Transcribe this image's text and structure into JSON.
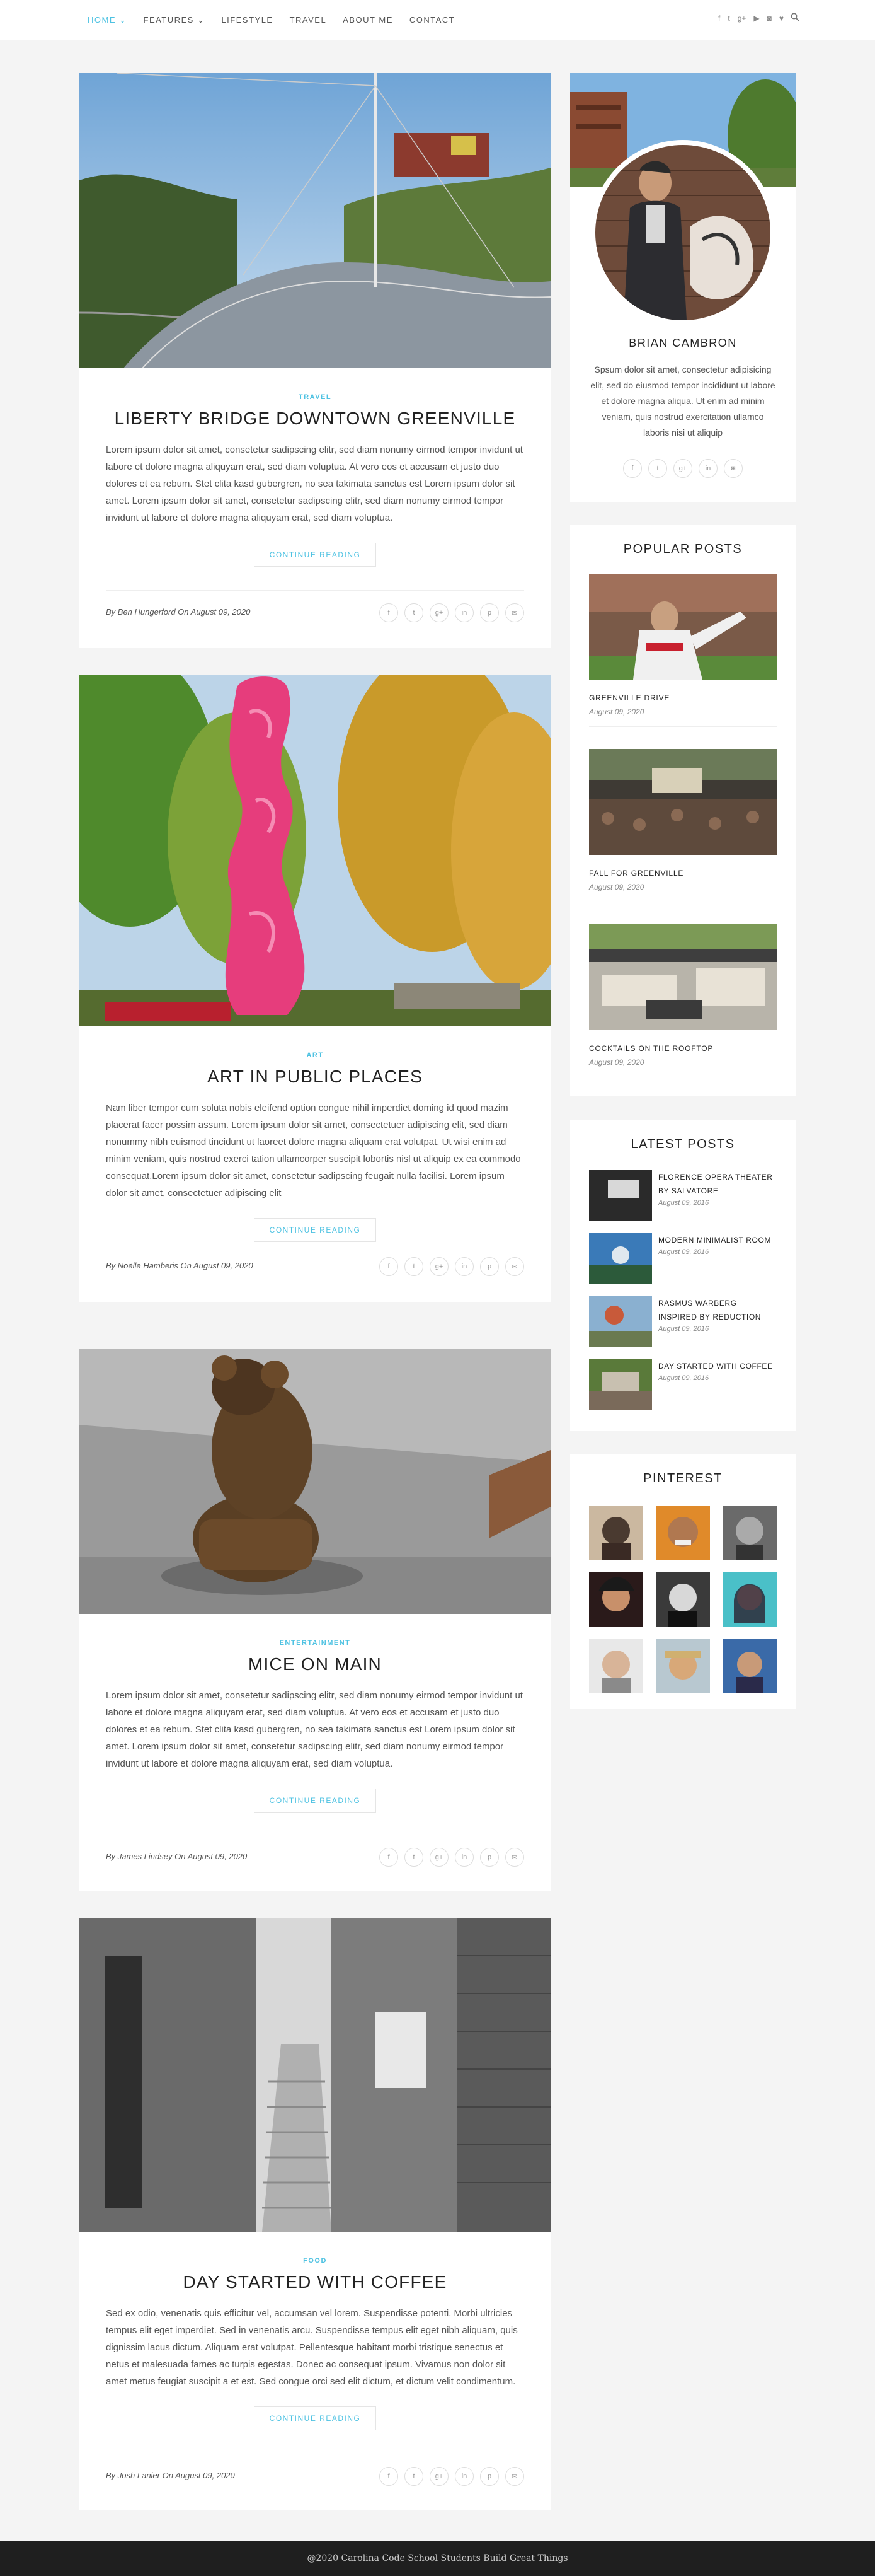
{
  "nav": {
    "items": [
      "HOME",
      "FEATURES",
      "LIFESTYLE",
      "TRAVEL",
      "ABOUT ME",
      "CONTACT"
    ],
    "dropdown_markers": [
      "⌄",
      "⌄"
    ],
    "social": [
      "f",
      "t",
      "g+",
      "▶",
      "◙",
      "♥"
    ],
    "accent": "#4ec2e2"
  },
  "posts": [
    {
      "category": "TRAVEL",
      "title": "LIBERTY BRIDGE DOWNTOWN GREENVILLE",
      "excerpt": "Lorem ipsum dolor sit amet, consetetur sadipscing elitr, sed diam nonumy eirmod tempor invidunt ut labore et dolore magna aliquyam erat, sed diam voluptua. At vero eos et accusam et justo duo dolores et ea rebum. Stet clita kasd gubergren, no sea takimata sanctus est Lorem ipsum dolor sit amet. Lorem ipsum dolor sit amet, consetetur sadipscing elitr, sed diam nonumy eirmod tempor invidunt ut labore et dolore magna aliquyam erat, sed diam voluptua.",
      "read_more": "CONTINUE READING",
      "author_line": "By Ben Hungerford On August 09, 2020"
    },
    {
      "category": "ART",
      "title": "ART IN PUBLIC PLACES",
      "excerpt": "Nam liber tempor cum soluta nobis eleifend option congue nihil imperdiet doming id quod mazim placerat facer possim assum. Lorem ipsum dolor sit amet, consectetuer adipiscing elit, sed diam nonummy nibh euismod tincidunt ut laoreet dolore magna aliquam erat volutpat. Ut wisi enim ad minim veniam, quis nostrud exerci tation ullamcorper suscipit lobortis nisl ut aliquip ex ea commodo consequat.Lorem ipsum dolor sit amet, consetetur sadipscing  feugait nulla facilisi. Lorem ipsum dolor sit amet, consectetuer adipiscing elit",
      "read_more": "CONTINUE READING",
      "author_line": "By Noëlle Hamberis On August 09, 2020"
    },
    {
      "category": "ENTERTAINMENT",
      "title": "MICE ON MAIN",
      "excerpt": "Lorem ipsum dolor sit amet, consetetur sadipscing elitr, sed diam nonumy eirmod tempor invidunt ut labore et dolore magna aliquyam erat, sed diam voluptua. At vero eos et accusam et justo duo dolores et ea rebum. Stet clita kasd gubergren, no sea takimata sanctus est Lorem ipsum dolor sit amet. Lorem ipsum dolor sit amet, consetetur sadipscing elitr, sed diam nonumy eirmod tempor invidunt ut labore et dolore magna aliquyam erat, sed diam voluptua.",
      "read_more": "CONTINUE READING",
      "author_line": "By James Lindsey On August 09, 2020"
    },
    {
      "category": "FOOD",
      "title": "DAY STARTED WITH COFFEE",
      "excerpt": "Sed ex odio, venenatis quis efficitur vel, accumsan vel lorem. Suspendisse potenti. Morbi ultricies tempus elit eget imperdiet. Sed in venenatis arcu. Suspendisse tempus elit eget nibh aliquam, quis dignissim lacus dictum. Aliquam erat volutpat. Pellentesque habitant morbi tristique senectus et netus et malesuada fames ac turpis egestas. Donec ac consequat ipsum. Vivamus non dolor sit amet metus feugiat suscipit a et est. Sed congue orci sed elit dictum, et dictum velit condimentum.",
      "read_more": "CONTINUE READING",
      "author_line": "By Josh Lanier On August 09, 2020"
    }
  ],
  "share_icons": [
    "f",
    "t",
    "g+",
    "in",
    "p",
    "✉"
  ],
  "about": {
    "name": "BRIAN CAMBRON",
    "text": "Spsum dolor sit amet, consectetur adipisicing elit, sed do eiusmod tempor incididunt ut labore et dolore magna aliqua. Ut enim ad minim veniam, quis nostrud exercitation ullamco laboris nisi ut aliquip",
    "social": [
      "f",
      "t",
      "g+",
      "in",
      "◙"
    ]
  },
  "popular": {
    "title": "POPULAR POSTS",
    "items": [
      {
        "name": "GREENVILLE DRIVE",
        "date": "August 09, 2020"
      },
      {
        "name": "FALL FOR GREENVILLE",
        "date": "August 09, 2020"
      },
      {
        "name": "COCKTAILS ON THE ROOFTOP",
        "date": "August 09, 2020"
      }
    ]
  },
  "latest": {
    "title": "LATEST POSTS",
    "items": [
      {
        "name": "FLORENCE OPERA THEATER BY SALVATORE",
        "date": "August 09, 2016"
      },
      {
        "name": "MODERN MINIMALIST ROOM",
        "date": "August 09, 2016"
      },
      {
        "name": "RASMUS WARBERG INSPIRED BY REDUCTION",
        "date": "August 09, 2016"
      },
      {
        "name": "DAY STARTED WITH COFFEE",
        "date": "August 09, 2016"
      }
    ]
  },
  "pinterest": {
    "title": "PINTEREST"
  },
  "footer": {
    "text": "@2020 Carolina Code School Students Build Great Things"
  }
}
